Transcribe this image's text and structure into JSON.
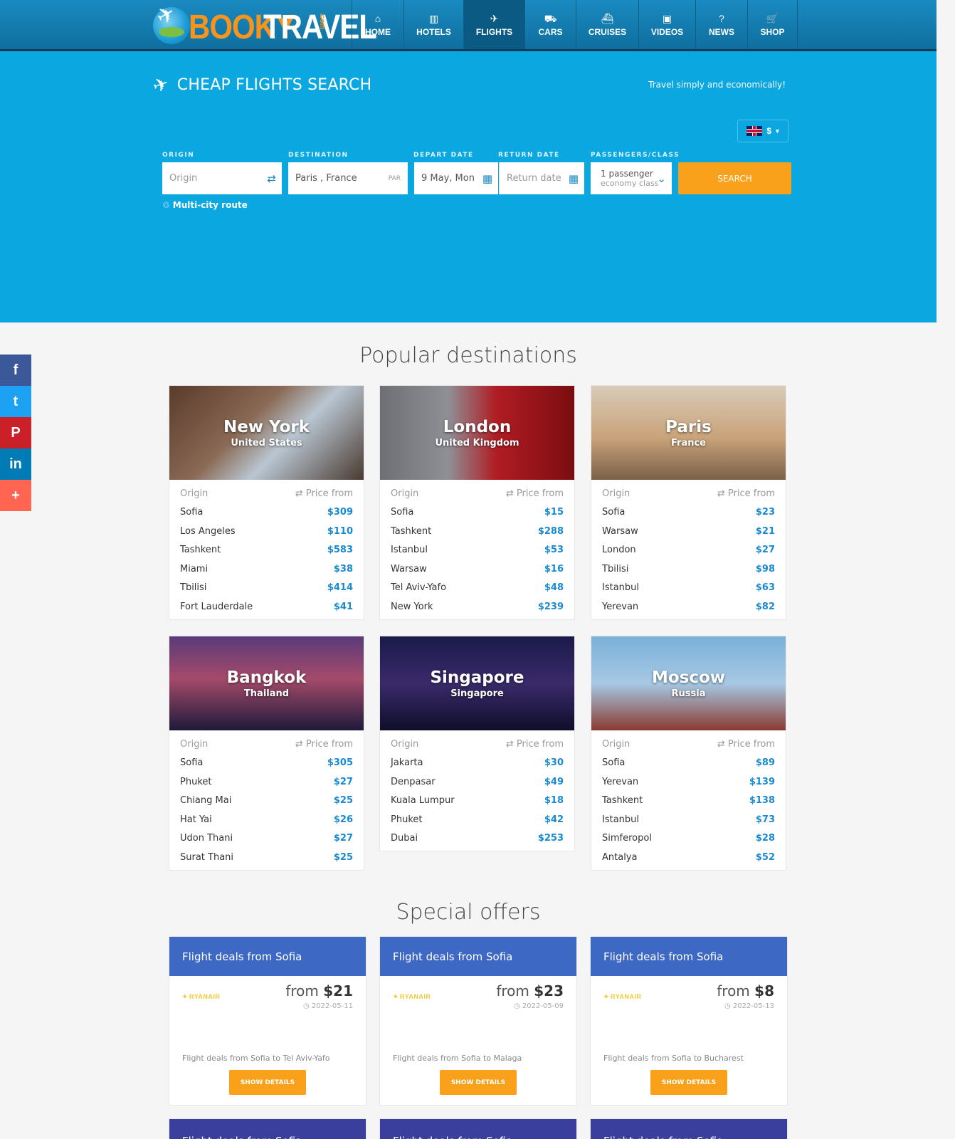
{
  "brand": {
    "logo_part1": "BOOKY",
    "logo_part2": "TRAVEL",
    "logo_dotcom": ".com"
  },
  "nav": [
    {
      "label": "HOME",
      "icon": "home-icon"
    },
    {
      "label": "HOTELS",
      "icon": "building-icon"
    },
    {
      "label": "FLIGHTS",
      "icon": "plane-icon",
      "active": true
    },
    {
      "label": "CARS",
      "icon": "car-icon"
    },
    {
      "label": "CRUISES",
      "icon": "ship-icon"
    },
    {
      "label": "VIDEOS",
      "icon": "video-icon"
    },
    {
      "label": "NEWS",
      "icon": "question-icon"
    },
    {
      "label": "SHOP",
      "icon": "cart-icon"
    }
  ],
  "hero": {
    "title": "CHEAP FLIGHTS SEARCH",
    "tagline": "Travel simply and economically!",
    "currency": "$",
    "labels": {
      "origin": "ORIGIN",
      "destination": "DESTINATION",
      "depart": "DEPART DATE",
      "return": "RETURN DATE",
      "passengers": "PASSENGERS/CLASS"
    },
    "origin_placeholder": "Origin",
    "destination_value": "Paris , France",
    "destination_code": "PAR",
    "depart_value": "9 May, Mon",
    "return_placeholder": "Return date",
    "passengers_value": "1 passenger",
    "class_value": "economy class",
    "search_label": "SEARCH",
    "multicity_label": "Multi-city route"
  },
  "popular": {
    "title": "Popular destinations",
    "origin_header": "Origin",
    "price_header": "Price from",
    "cards": [
      {
        "city": "New York",
        "country": "United States",
        "bg": "linear-gradient(135deg,#5a3a2a,#8a6a55 40%,#b9c6d2 60%,#4a3a30)",
        "rows": [
          [
            "Sofia",
            "$309"
          ],
          [
            "Los Angeles",
            "$110"
          ],
          [
            "Tashkent",
            "$583"
          ],
          [
            "Miami",
            "$38"
          ],
          [
            "Tbilisi",
            "$414"
          ],
          [
            "Fort Lauderdale",
            "$41"
          ]
        ]
      },
      {
        "city": "London",
        "country": "United Kingdom",
        "bg": "linear-gradient(90deg,#6d6f74,#8e9096 35%,#b01c22 60%,#7a0d10)",
        "rows": [
          [
            "Sofia",
            "$15"
          ],
          [
            "Tashkent",
            "$288"
          ],
          [
            "Istanbul",
            "$53"
          ],
          [
            "Warsaw",
            "$16"
          ],
          [
            "Tel Aviv-Yafo",
            "$48"
          ],
          [
            "New York",
            "$239"
          ]
        ]
      },
      {
        "city": "Paris",
        "country": "France",
        "bg": "linear-gradient(180deg,#d8cbb8,#c9a37a 55%,#7a6048)",
        "rows": [
          [
            "Sofia",
            "$23"
          ],
          [
            "Warsaw",
            "$21"
          ],
          [
            "London",
            "$27"
          ],
          [
            "Tbilisi",
            "$98"
          ],
          [
            "Istanbul",
            "$63"
          ],
          [
            "Yerevan",
            "$82"
          ]
        ]
      },
      {
        "city": "Bangkok",
        "country": "Thailand",
        "bg": "linear-gradient(180deg,#5a3a7a,#a54a6a 45%,#1e1a3a)",
        "rows": [
          [
            "Sofia",
            "$305"
          ],
          [
            "Phuket",
            "$27"
          ],
          [
            "Chiang Mai",
            "$25"
          ],
          [
            "Hat Yai",
            "$26"
          ],
          [
            "Udon Thani",
            "$27"
          ],
          [
            "Surat Thani",
            "$25"
          ]
        ]
      },
      {
        "city": "Singapore",
        "country": "Singapore",
        "bg": "linear-gradient(180deg,#1a1a4a,#3a2a6a 50%,#0e0e2a)",
        "rows": [
          [
            "Jakarta",
            "$30"
          ],
          [
            "Denpasar",
            "$49"
          ],
          [
            "Kuala Lumpur",
            "$18"
          ],
          [
            "Phuket",
            "$42"
          ],
          [
            "Dubai",
            "$253"
          ]
        ]
      },
      {
        "city": "Moscow",
        "country": "Russia",
        "bg": "linear-gradient(180deg,#7ab0d8,#a6c8e4 50%,#8a3a30)",
        "rows": [
          [
            "Sofia",
            "$89"
          ],
          [
            "Yerevan",
            "$139"
          ],
          [
            "Tashkent",
            "$138"
          ],
          [
            "Istanbul",
            "$73"
          ],
          [
            "Simferopol",
            "$28"
          ],
          [
            "Antalya",
            "$52"
          ]
        ]
      }
    ]
  },
  "offers": {
    "title": "Special offers",
    "items": [
      {
        "head": "Flight deals from Sofia",
        "airline": "RYANAIR",
        "from": "from",
        "price": "$21",
        "date": "2022-05-11",
        "desc": "Flight deals from Sofia to Tel Aviv-Yafo",
        "btn": "SHOW DETAILS"
      },
      {
        "head": "Flight deals from Sofia",
        "airline": "RYANAIR",
        "from": "from",
        "price": "$23",
        "date": "2022-05-09",
        "desc": "Flight deals from Sofia to Malaga",
        "btn": "SHOW DETAILS"
      },
      {
        "head": "Flight deals from Sofia",
        "airline": "RYANAIR",
        "from": "from",
        "price": "$8",
        "date": "2022-05-13",
        "desc": "Flight deals from Sofia to Bucharest",
        "btn": "SHOW DETAILS"
      }
    ],
    "partial": [
      "Flight deals from Sofia",
      "Flight deals from Sofia",
      "Flight deals from Sofia"
    ]
  },
  "social": [
    {
      "name": "facebook",
      "glyph": "f",
      "color": "#3b5998"
    },
    {
      "name": "twitter",
      "glyph": "t",
      "color": "#1da1f2"
    },
    {
      "name": "pinterest",
      "glyph": "P",
      "color": "#cb2027"
    },
    {
      "name": "linkedin",
      "glyph": "in",
      "color": "#007bb5"
    },
    {
      "name": "share",
      "glyph": "+",
      "color": "#ff6550"
    }
  ]
}
